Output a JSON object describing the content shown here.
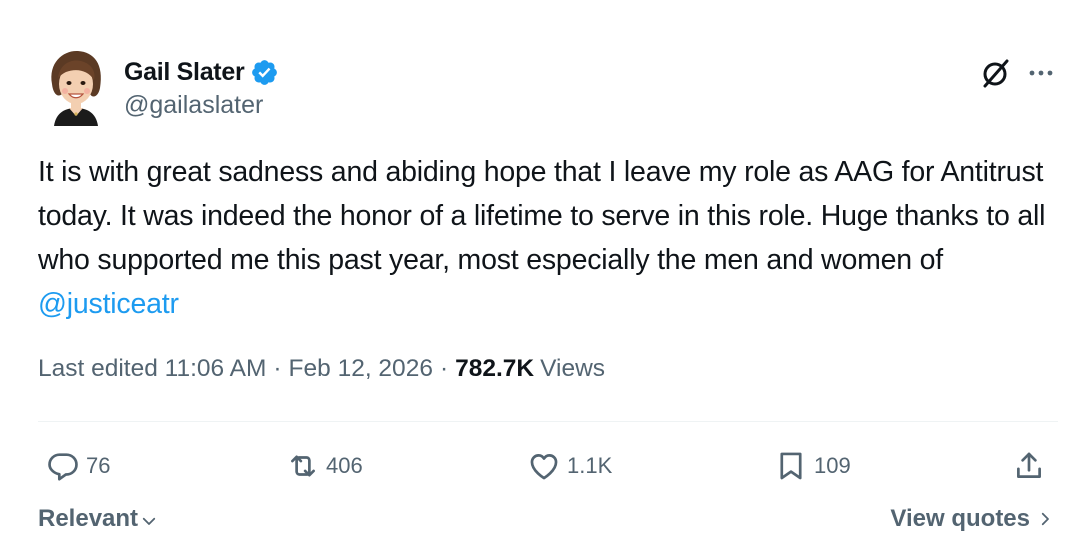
{
  "author": {
    "display_name": "Gail Slater",
    "handle": "@gailaslater",
    "verified": true,
    "avatar_icon": "cartoon-avatar-icon"
  },
  "header_actions": {
    "grok_icon": "grok-slash-icon",
    "more_icon": "more-dots-icon"
  },
  "tweet": {
    "text_before_mention": "It is with great sadness and abiding hope that I leave my role as AAG for Antitrust today. It was indeed the honor of a lifetime to serve in this role. Huge thanks to all who supported me this past year, most especially the men and women of ",
    "mention": "@justiceatr"
  },
  "meta": {
    "edited": "Last edited 11:06 AM",
    "separator": "·",
    "date": "Feb 12, 2026",
    "views_count": "782.7K",
    "views_label": "Views"
  },
  "actions": {
    "replies": "76",
    "reposts": "406",
    "likes": "1.1K",
    "bookmarks": "109"
  },
  "footer": {
    "sort_label": "Relevant",
    "view_quotes_label": "View quotes"
  },
  "colors": {
    "accent": "#1d9bf0",
    "secondary_text": "#536471",
    "primary_text": "#0f1419"
  }
}
